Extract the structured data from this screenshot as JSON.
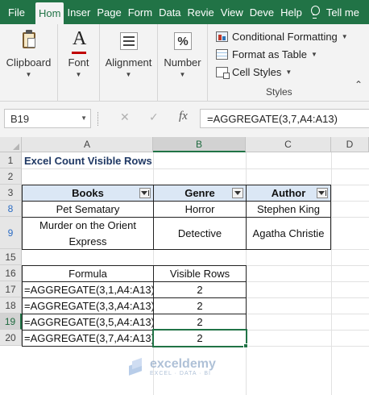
{
  "tabs": [
    {
      "label": "File"
    },
    {
      "label": "Hom"
    },
    {
      "label": "Inser"
    },
    {
      "label": "Page"
    },
    {
      "label": "Form"
    },
    {
      "label": "Data"
    },
    {
      "label": "Revie"
    },
    {
      "label": "View"
    },
    {
      "label": "Deve"
    },
    {
      "label": "Help"
    }
  ],
  "active_tab": "Hom",
  "tell_me": "Tell me",
  "ribbon": {
    "clipboard": "Clipboard",
    "font": "Font",
    "font_icon": "A",
    "alignment": "Alignment",
    "number": "Number",
    "number_icon": "%",
    "styles": {
      "conditional_formatting": "Conditional Formatting",
      "format_as_table": "Format as Table",
      "cell_styles": "Cell Styles",
      "group_label": "Styles"
    }
  },
  "formula_bar": {
    "name_box": "B19",
    "cancel": "✕",
    "enter": "✓",
    "fx": "fx",
    "formula": "=AGGREGATE(3,7,A4:A13)"
  },
  "columns": [
    "A",
    "B",
    "C",
    "D"
  ],
  "rows": [
    "1",
    "2",
    "3",
    "8",
    "9",
    "15",
    "16",
    "17",
    "18",
    "19",
    "20"
  ],
  "sheet": {
    "title": "Excel Count Visible Rows",
    "table_headers": [
      "Books",
      "Genre",
      "Author"
    ],
    "table_rows": [
      {
        "book": "Pet Sematary",
        "genre": "Horror",
        "author": "Stephen King"
      },
      {
        "book": "Murder on the Orient Express",
        "genre": "Detective",
        "author": "Agatha Christie"
      }
    ],
    "formula_headers": [
      "Formula",
      "Visible Rows"
    ],
    "formula_rows": [
      {
        "formula": "=AGGREGATE(3,1,A4:A13)",
        "value": "2"
      },
      {
        "formula": "=AGGREGATE(3,3,A4:A13)",
        "value": "2"
      },
      {
        "formula": "=AGGREGATE(3,5,A4:A13)",
        "value": "2"
      },
      {
        "formula": "=AGGREGATE(3,7,A4:A13)",
        "value": "2"
      }
    ]
  },
  "watermark": {
    "name": "exceldemy",
    "tagline": "EXCEL · DATA · BI"
  }
}
